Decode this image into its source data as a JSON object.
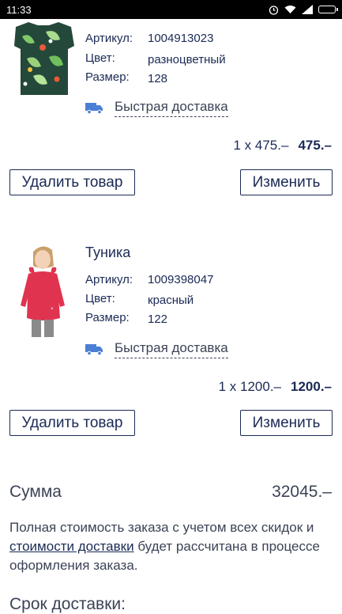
{
  "status_bar": {
    "time": "11:33",
    "signal_icon": "signal-icon",
    "wifi_icon": "wifi-icon",
    "battery_icon": "battery-icon"
  },
  "labels": {
    "sku": "Артикул:",
    "color": "Цвет:",
    "size": "Размер:"
  },
  "items": [
    {
      "title": "",
      "sku": "1004913023",
      "color": "разноцветный",
      "size": "128",
      "delivery": "Быстрая доставка",
      "qty_price": "1 x 475.–",
      "total": "475.–",
      "remove_label": "Удалить товар",
      "edit_label": "Изменить"
    },
    {
      "title": "Туника",
      "sku": "1009398047",
      "color": "красный",
      "size": "122",
      "delivery": "Быстрая доставка",
      "qty_price": "1 x 1200.–",
      "total": "1200.–",
      "remove_label": "Удалить товар",
      "edit_label": "Изменить"
    }
  ],
  "summary": {
    "label": "Сумма",
    "value": "32045.–",
    "note_before": "Полная стоимость заказа с учетом всех скидок и ",
    "note_link": "стоимости доставки",
    "note_after": " будет рассчитана в процессе оформления заказа."
  },
  "next_heading": "Срок доставки:",
  "colors": {
    "text": "#1b2a55",
    "muted": "#3c4356",
    "truck": "#4a7fd6"
  }
}
